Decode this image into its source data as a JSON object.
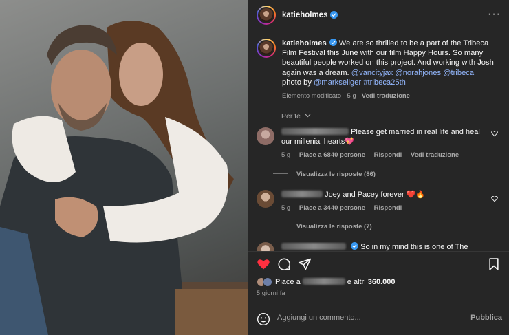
{
  "post": {
    "username": "katieholmes",
    "more_icon": "more-horizontal-icon",
    "verified_icon": "verified-badge-icon"
  },
  "caption": {
    "username": "katieholmes",
    "text": " We are so thrilled to be a part of the Tribeca Film Festival this June with our film Happy Hours. So many beautiful people worked on this project. And working with Josh again was a dream. ",
    "mentions": [
      "@vancityjax",
      "@norahjones",
      "@tribeca"
    ],
    "photo_by_prefix": "photo by ",
    "photographer": "@markseliger",
    "hashtag": "#tribeca25th",
    "edited_label": "Elemento modificato",
    "age": "5 g",
    "translate_label": "Vedi traduzione"
  },
  "comments_filter": {
    "label": "Per te",
    "icon": "chevron-down-icon"
  },
  "comments": [
    {
      "text": "Please get married in real life and heal our millenial hearts💖",
      "age": "5 g",
      "likes": "Piace a 6840 persone",
      "reply_label": "Rispondi",
      "translate_label": "Vedi traduzione",
      "view_replies": "Visualizza le risposte (86)"
    },
    {
      "text": "Joey and Pacey forever ❤️🔥",
      "age": "5 g",
      "likes": "Piace a 3440 persone",
      "reply_label": "Rispondi",
      "view_replies": "Visualizza le risposte (7)"
    },
    {
      "text": "So in my mind this is one of The Witter"
    }
  ],
  "actions": {
    "like_icon": "heart-filled-icon",
    "comment_icon": "comment-icon",
    "share_icon": "send-icon",
    "save_icon": "bookmark-icon",
    "like_color": "#ff3040"
  },
  "likes": {
    "prefix": "Piace a ",
    "middle": " e altri ",
    "count": "360.000"
  },
  "timestamp": "5 giorni fa",
  "add_comment": {
    "placeholder": "Aggiungi un commento...",
    "publish_label": "Pubblica",
    "emoji_icon": "emoji-icon"
  },
  "colors": {
    "panel": "#262626",
    "link": "#94b8ff",
    "muted": "#a8a8a8"
  }
}
